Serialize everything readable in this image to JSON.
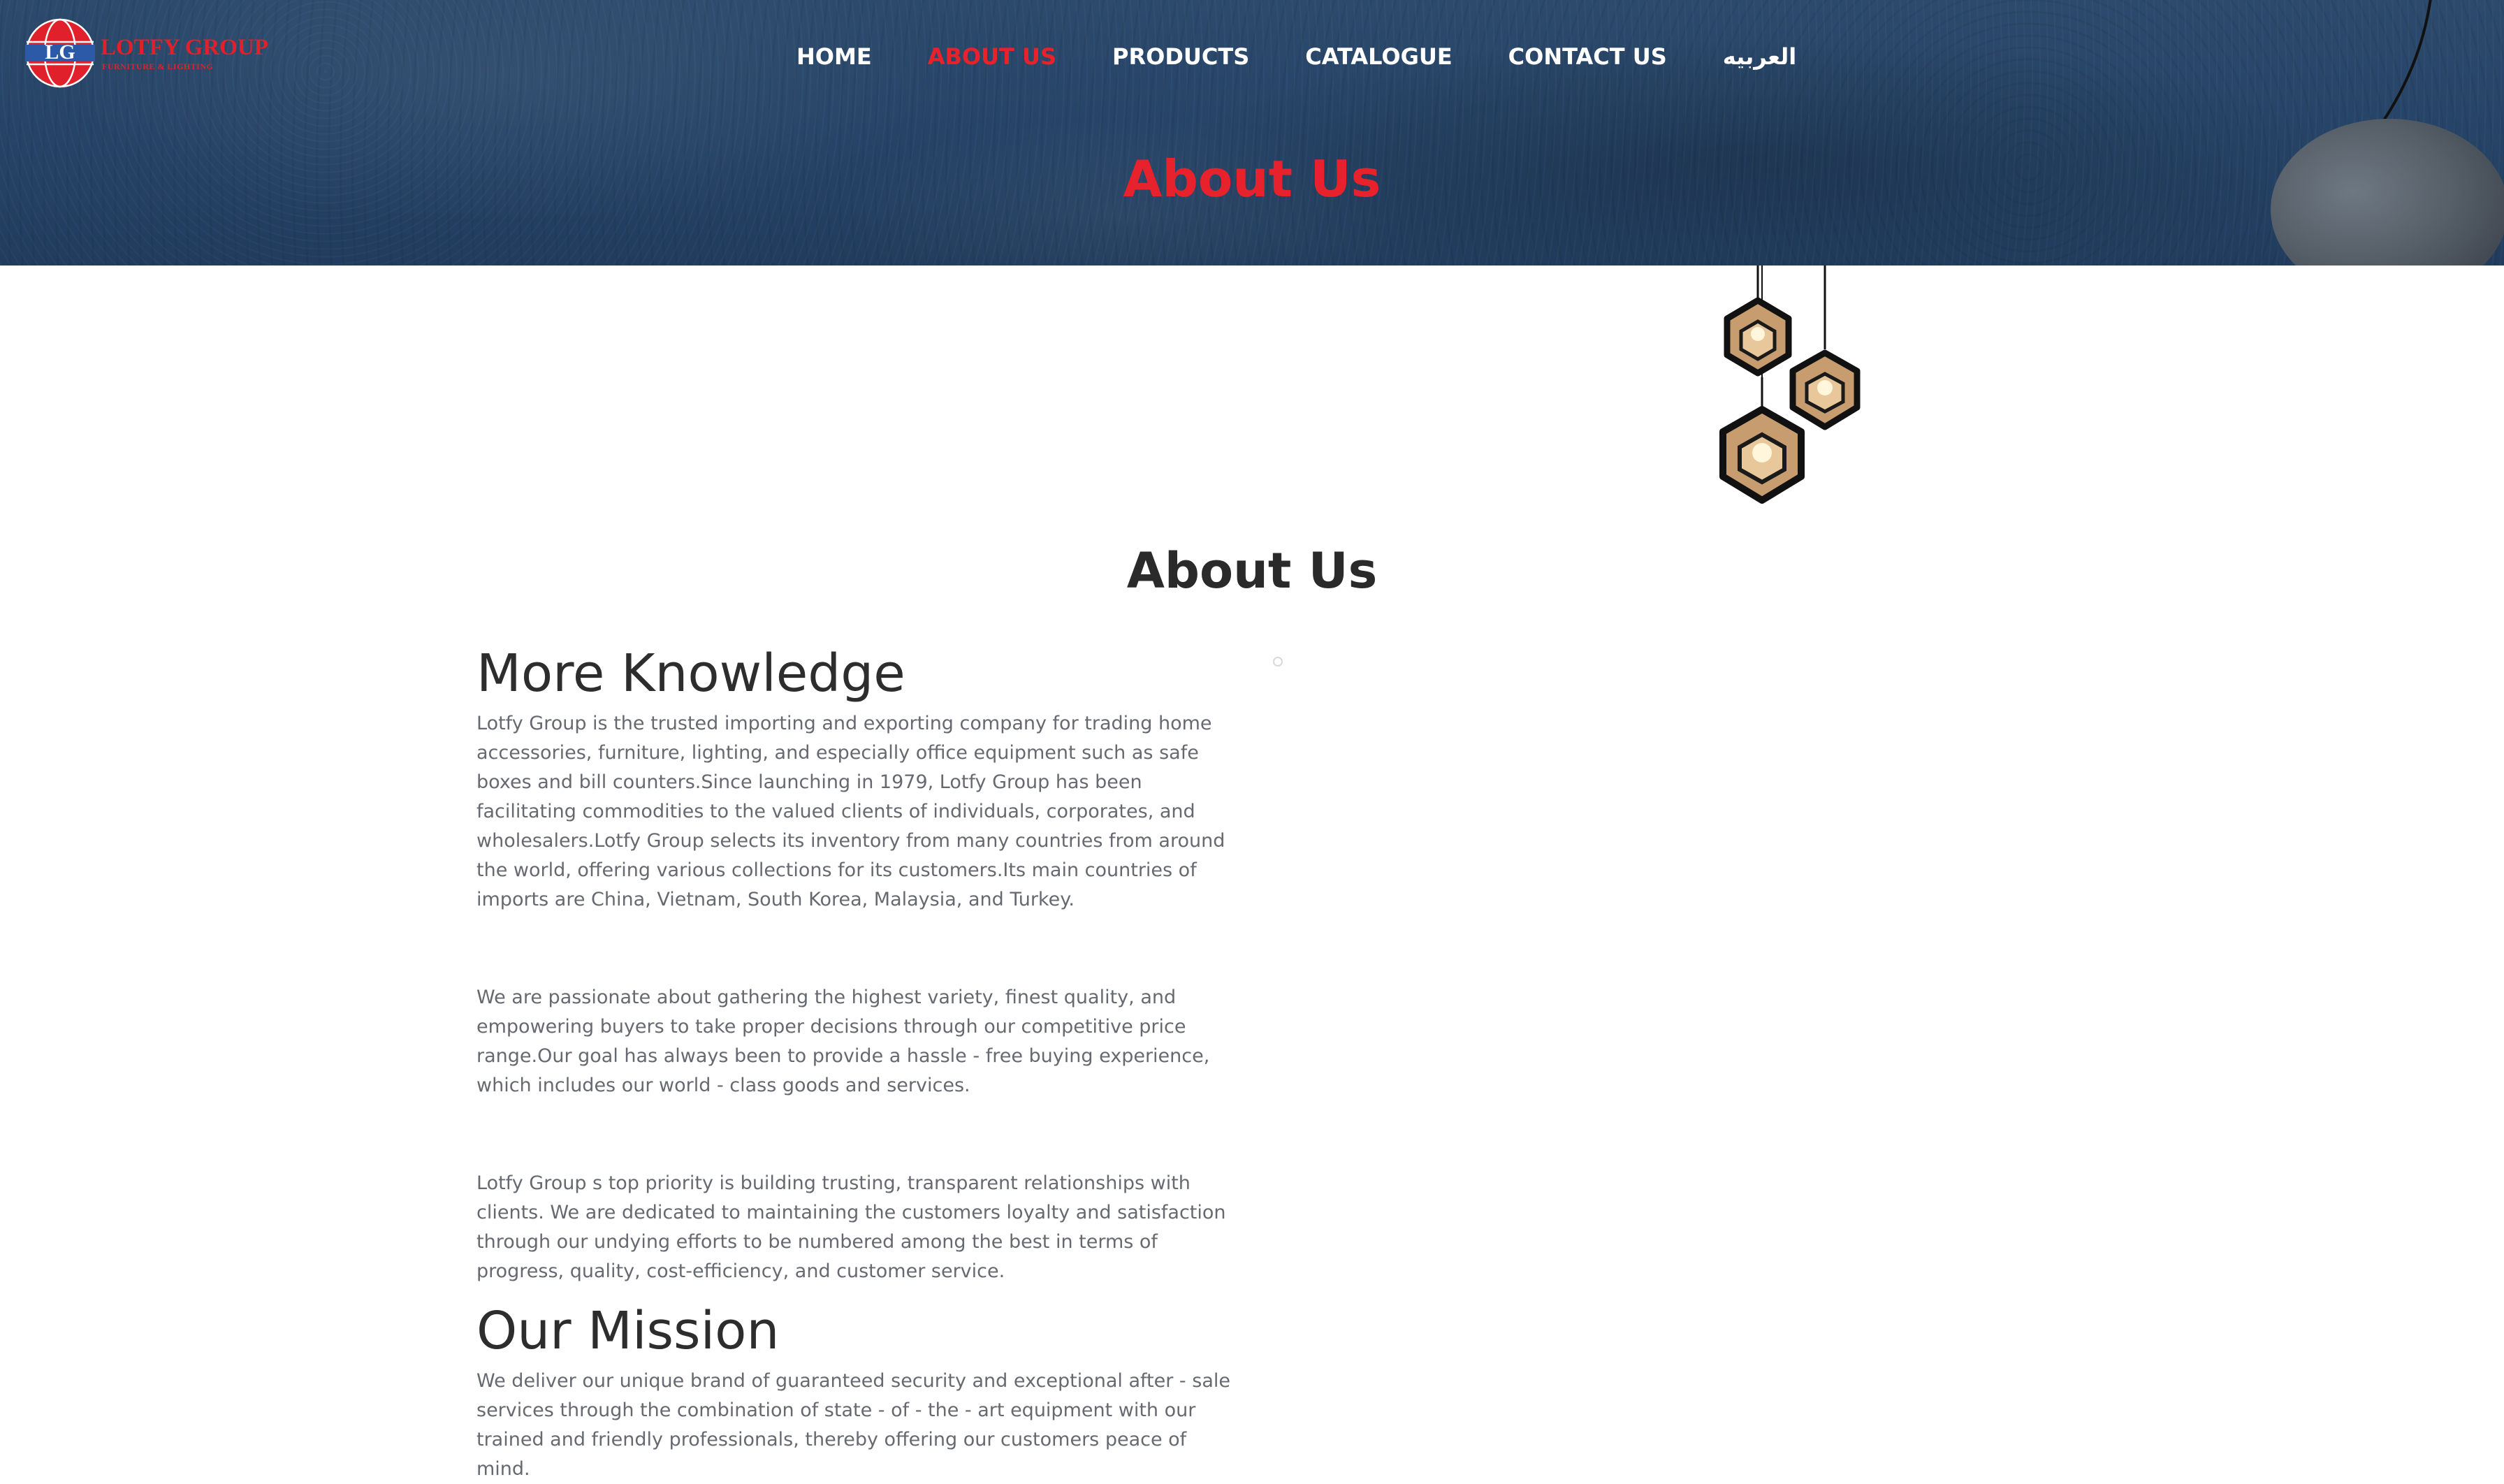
{
  "logo": {
    "initials": "LG",
    "name": "LOTFY GROUP",
    "tagline": "FURNITURE & LIGHTING"
  },
  "nav": {
    "items": [
      {
        "label": "HOME",
        "active": false
      },
      {
        "label": "ABOUT US",
        "active": true
      },
      {
        "label": "PRODUCTS",
        "active": false
      },
      {
        "label": "CATALOGUE",
        "active": false
      },
      {
        "label": "CONTACT US",
        "active": false
      },
      {
        "label": "العربيه",
        "active": false
      }
    ]
  },
  "hero": {
    "title": "About Us"
  },
  "main": {
    "title": "About Us",
    "knowledge_heading": "More Knowledge",
    "paragraphs": [
      "Lotfy Group is the trusted importing and exporting company for trading home accessories, furniture, lighting, and especially office equipment such as safe boxes and bill counters.Since launching in 1979, Lotfy Group has been facilitating commodities to the valued clients of individuals, corporates, and wholesalers.Lotfy Group selects its inventory from many countries from around the world, offering various collections for its customers.Its main countries of imports are China, Vietnam, South Korea, Malaysia, and Turkey.",
      "We are passionate about gathering the highest variety, finest quality, and empowering buyers to take proper decisions through our competitive price range.Our goal has always been to provide a hassle - free buying experience, which includes our world - class goods and services.",
      "Lotfy Group s top priority is building trusting, transparent relationships with clients. We are dedicated to maintaining the customers loyalty and satisfaction through our undying efforts to be numbered among the best in terms of progress, quality, cost-efficiency, and customer service."
    ],
    "mission_heading": "Our Mission",
    "mission_text": "We deliver our unique brand of guaranteed security and exceptional after - sale services through the combination of state - of - the - art equipment with our trained and friendly professionals, thereby offering our customers peace of mind."
  },
  "colors": {
    "accent": "#e8222c",
    "hero_bg": "#264467",
    "text_body": "#666a70",
    "heading": "#2d2d2d"
  }
}
